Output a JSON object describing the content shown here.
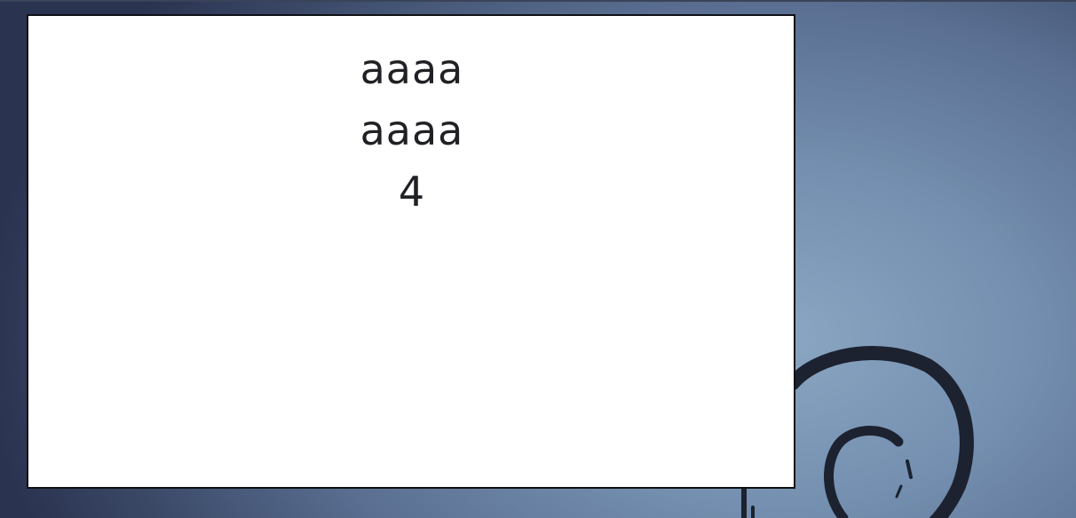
{
  "window": {
    "lines": [
      "aaaa",
      "aaaa",
      "4"
    ]
  },
  "desktop": {
    "background_color": "#7590b0",
    "logo_icon": "debian-swirl-icon",
    "logo_color": "#1c2230"
  }
}
